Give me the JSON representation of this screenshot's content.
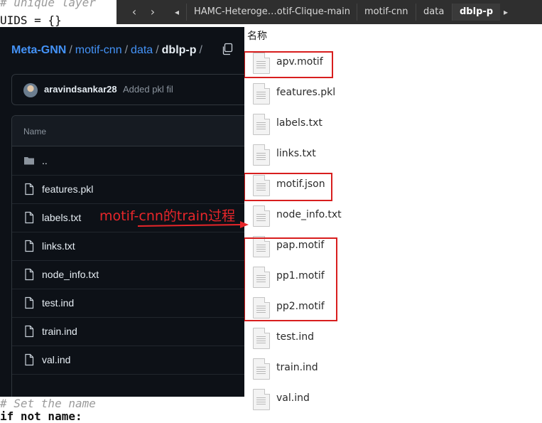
{
  "background_code": {
    "line1": "# unique layer",
    "line2": "UIDS = {}",
    "line3": "# Set the name",
    "line4": "if not name:"
  },
  "file_manager": {
    "nav_back": "‹",
    "nav_forward": "›",
    "nav_left": "◂",
    "nav_right": "▸",
    "breadcrumbs": [
      "HAMC-Heteroge…otif-Clique-main",
      "motif-cnn",
      "data",
      "dblp-p"
    ],
    "column_header": "名称",
    "files": [
      {
        "name": "apv.motif",
        "highlighted": true
      },
      {
        "name": "features.pkl",
        "highlighted": false
      },
      {
        "name": "labels.txt",
        "highlighted": false
      },
      {
        "name": "links.txt",
        "highlighted": false
      },
      {
        "name": "motif.json",
        "highlighted": true
      },
      {
        "name": "node_info.txt",
        "highlighted": false
      },
      {
        "name": "pap.motif",
        "highlighted": true
      },
      {
        "name": "pp1.motif",
        "highlighted": true
      },
      {
        "name": "pp2.motif",
        "highlighted": true
      },
      {
        "name": "test.ind",
        "highlighted": false
      },
      {
        "name": "train.ind",
        "highlighted": false
      },
      {
        "name": "val.ind",
        "highlighted": false
      }
    ]
  },
  "github": {
    "breadcrumb": {
      "repo": "Meta-GNN",
      "folder1": "motif-cnn",
      "folder2": "data",
      "current": "dblp-p",
      "sep": "/"
    },
    "commit": {
      "author": "aravindsankar28",
      "message": "Added pkl fil"
    },
    "column_name": "Name",
    "rows": [
      {
        "name": "..",
        "type": "folder"
      },
      {
        "name": "features.pkl",
        "type": "file"
      },
      {
        "name": "labels.txt",
        "type": "file"
      },
      {
        "name": "links.txt",
        "type": "file"
      },
      {
        "name": "node_info.txt",
        "type": "file"
      },
      {
        "name": "test.ind",
        "type": "file"
      },
      {
        "name": "train.ind",
        "type": "file"
      },
      {
        "name": "val.ind",
        "type": "file"
      }
    ]
  },
  "annotation": {
    "text": "motif-cnn的train过程",
    "color": "#e8262a"
  }
}
